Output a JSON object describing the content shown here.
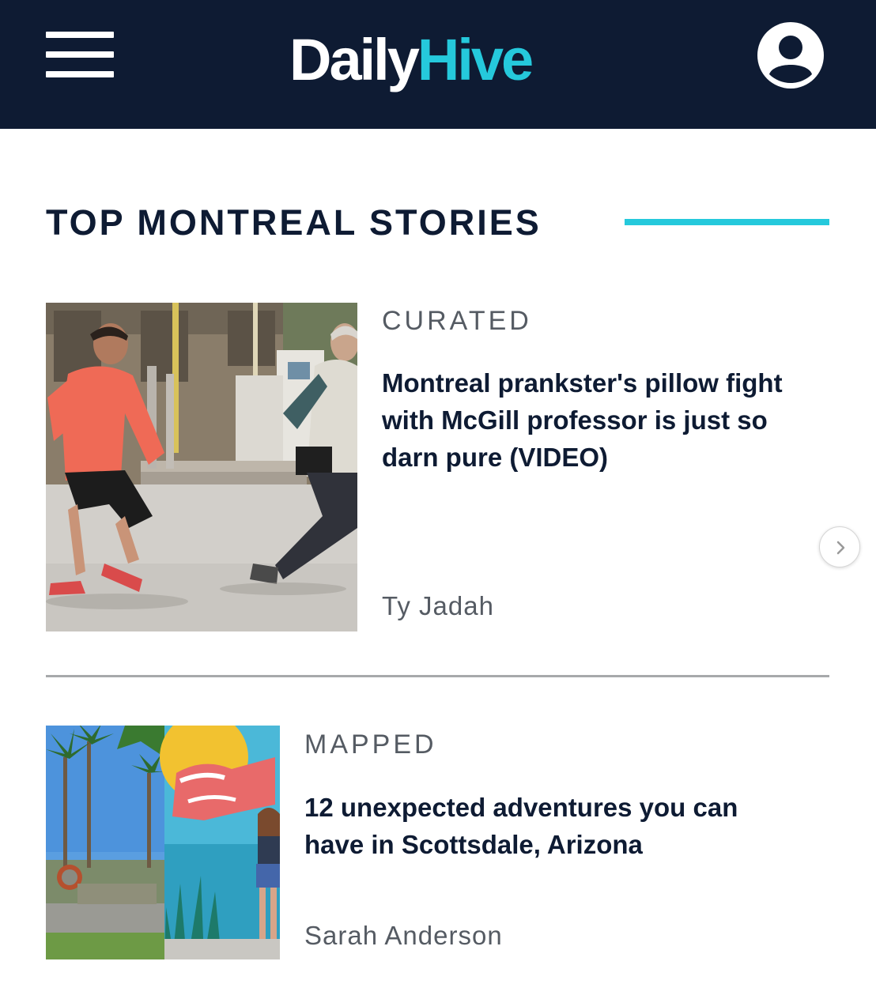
{
  "header": {
    "logo_part1": "Daily",
    "logo_part2": "Hive",
    "menu_icon": "hamburger-menu-icon",
    "account_icon": "user-account-icon"
  },
  "section": {
    "title": "TOP MONTREAL STORIES"
  },
  "stories": [
    {
      "tag": "CURATED",
      "headline": "Montreal prankster's pillow fight with McGill professor is just so darn pure (VIDEO)",
      "author": "Ty Jadah"
    },
    {
      "tag": "MAPPED",
      "headline": "12 unexpected adventures you can have in Scottsdale, Arizona",
      "author": "Sarah Anderson"
    }
  ],
  "carousel": {
    "next_icon": "chevron-right-icon"
  },
  "colors": {
    "navy": "#0e1b33",
    "accent": "#25c9dc",
    "muted_text": "#555b63"
  }
}
